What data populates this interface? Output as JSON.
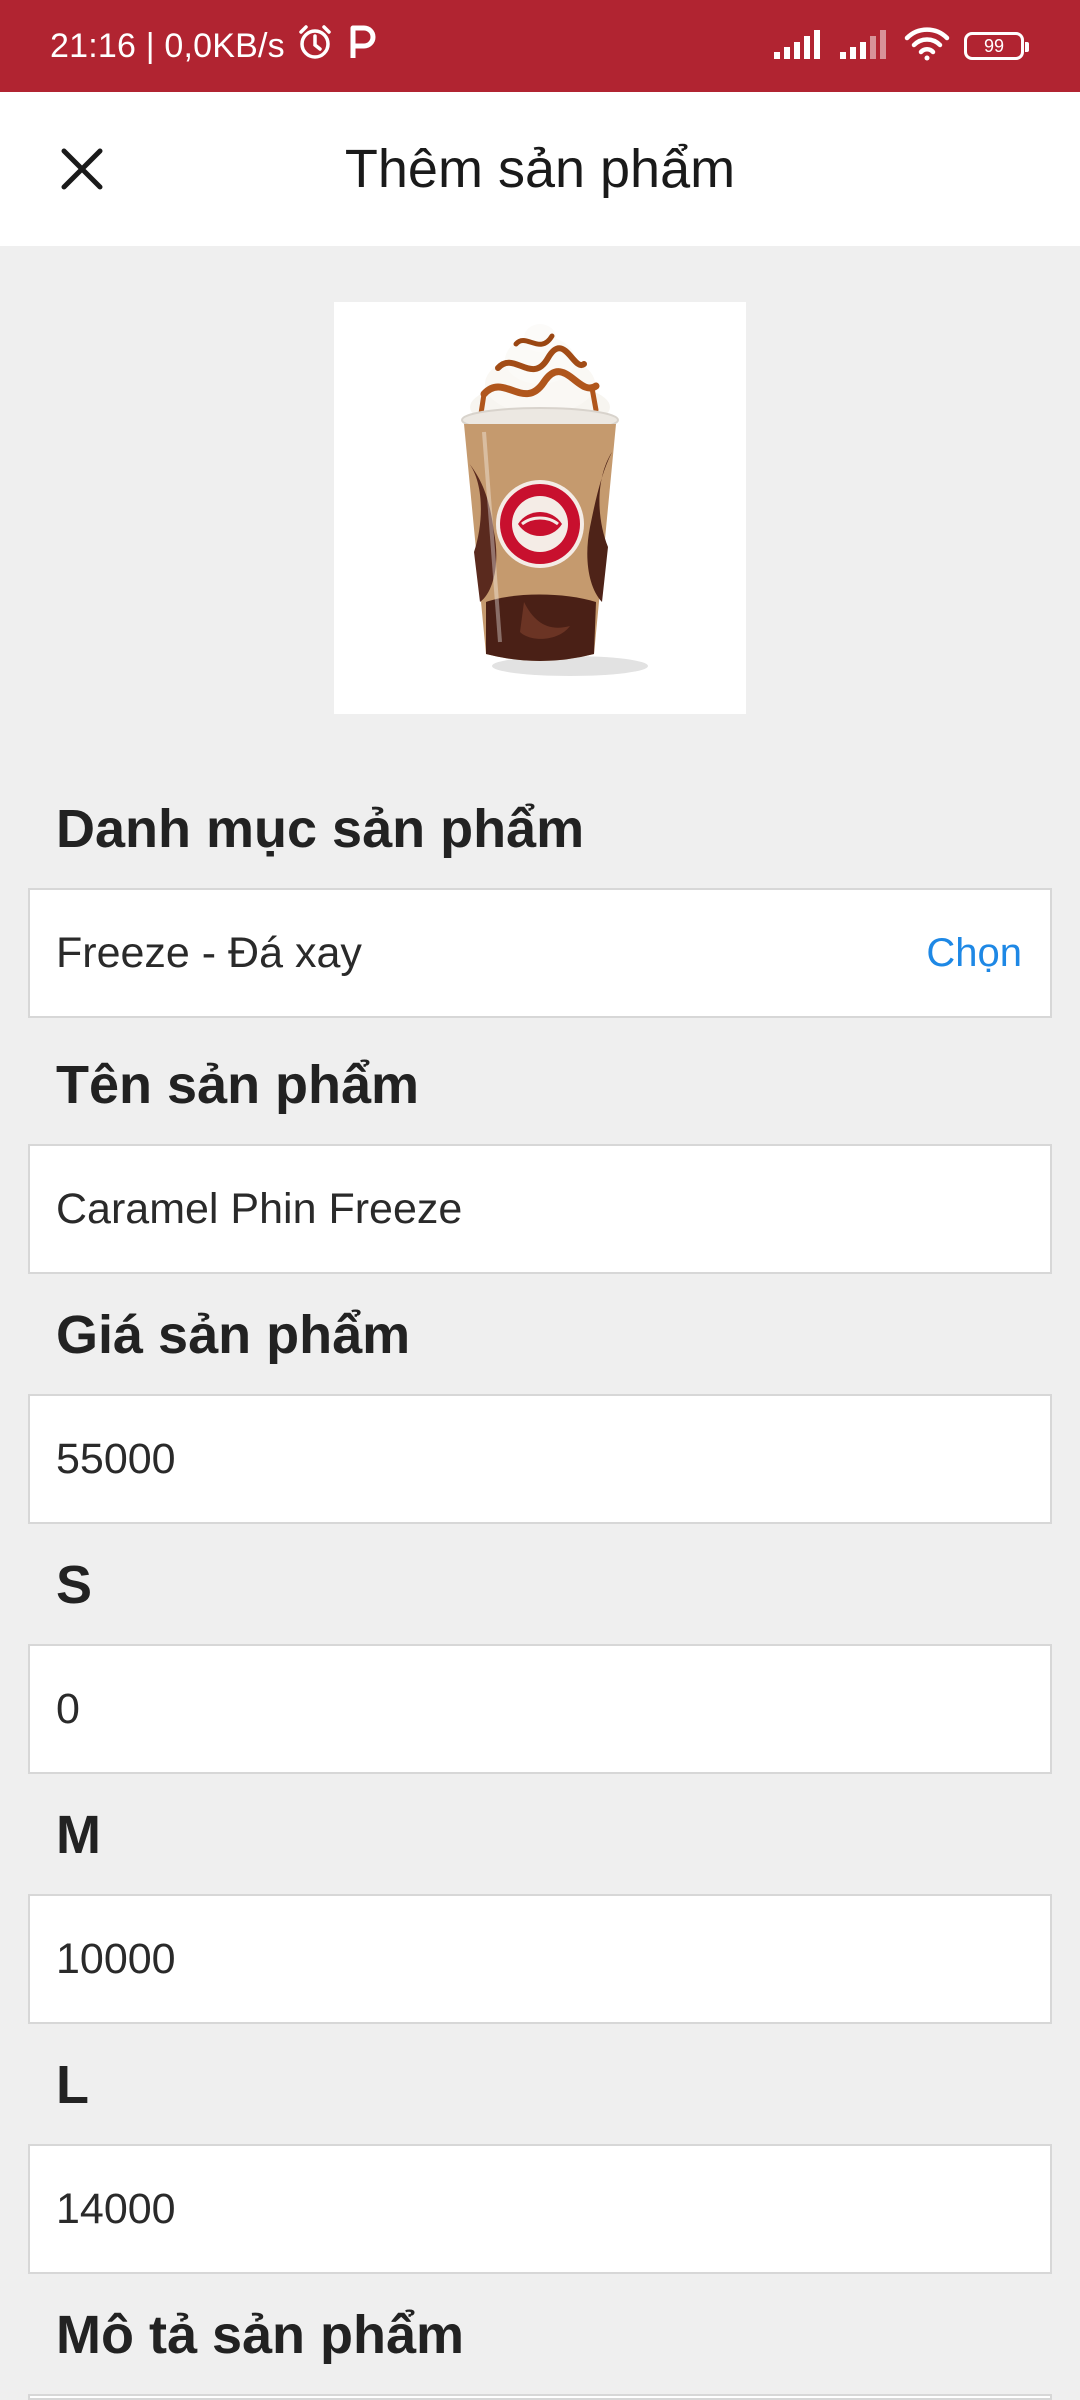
{
  "status_bar": {
    "time_info": "21:16 | 0,0KB/s",
    "battery": "99",
    "icons": [
      "alarm-icon",
      "parking-icon",
      "signal-icon",
      "signal-icon",
      "wifi-icon",
      "battery-icon"
    ]
  },
  "header": {
    "title": "Thêm sản phẩm",
    "close_icon": "close-icon"
  },
  "product": {
    "image_icon": "highlands-coffee-drink-image"
  },
  "form": {
    "category": {
      "label": "Danh mục sản phẩm",
      "value": "Freeze - Đá xay",
      "choose_label": "Chọn"
    },
    "name": {
      "label": "Tên sản phẩm",
      "value": "Caramel Phin Freeze"
    },
    "price": {
      "label": "Giá sản phẩm",
      "value": "55000"
    },
    "size_s": {
      "label": "S",
      "value": "0"
    },
    "size_m": {
      "label": "M",
      "value": "10000"
    },
    "size_l": {
      "label": "L",
      "value": "14000"
    },
    "description": {
      "label": "Mô tả sản phẩm"
    }
  },
  "colors": {
    "status_bar": "#b12431",
    "background": "#efefef",
    "link": "#1e88e5",
    "drink_logo": "#c8102e"
  }
}
